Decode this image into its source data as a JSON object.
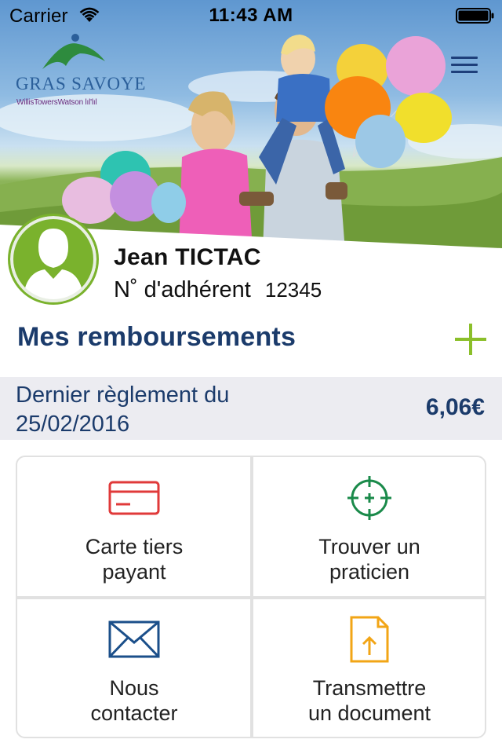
{
  "status_bar": {
    "carrier": "Carrier",
    "time": "11:43 AM"
  },
  "brand": {
    "name": "GRAS SAVOYE",
    "subline": "WillisTowersWatson lıl'lıl",
    "colors": {
      "green": "#2e8b3e",
      "blue": "#2b5f9a",
      "purple": "#6b2b7e"
    }
  },
  "header": {
    "menu_icon": "hamburger-menu-icon"
  },
  "profile": {
    "name": "Jean TICTAC",
    "member_label": "N˚ d'adhérent",
    "member_number": "12345",
    "avatar_color": "#7ab22d"
  },
  "reimbursements": {
    "title": "Mes remboursements",
    "add_icon": "plus-icon",
    "last_payment_label": "Dernier règlement du 25/02/2016",
    "last_payment_amount": "6,06€"
  },
  "tiles": [
    {
      "label": "Carte tiers\npayant",
      "icon": "card-icon",
      "color": "#e03a3a"
    },
    {
      "label": "Trouver un\npraticien",
      "icon": "crosshair-icon",
      "color": "#1a8a4a"
    },
    {
      "label": "Nous\ncontacter",
      "icon": "envelope-icon",
      "color": "#1b4f8a"
    },
    {
      "label": "Transmettre\nun document",
      "icon": "upload-document-icon",
      "color": "#f2a516"
    }
  ]
}
